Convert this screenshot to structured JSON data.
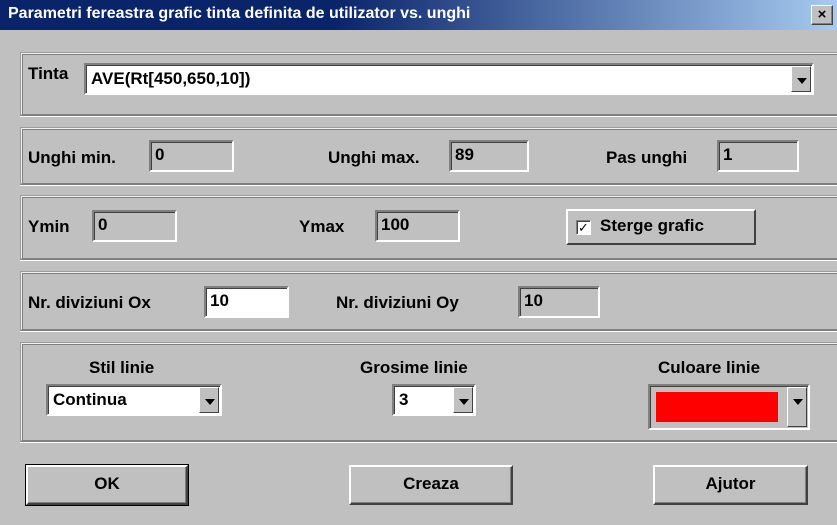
{
  "window": {
    "title": "Parametri fereastra grafic tinta definita de utilizator vs. unghi",
    "close_glyph": "×"
  },
  "tinta": {
    "label": "Tinta",
    "value": "AVE(Rt[450,650,10])"
  },
  "angles": {
    "min_label": "Unghi min.",
    "min_value": "0",
    "max_label": "Unghi max.",
    "max_value": "89",
    "step_label": "Pas unghi",
    "step_value": "1"
  },
  "yrange": {
    "ymin_label": "Ymin",
    "ymin_value": "0",
    "ymax_label": "Ymax",
    "ymax_value": "100",
    "clear_label": "Sterge grafic",
    "clear_checked": true,
    "check_glyph": "✓"
  },
  "divisions": {
    "ox_label": "Nr. diviziuni Ox",
    "ox_value": "10",
    "oy_label": "Nr. diviziuni Oy",
    "oy_value": "10"
  },
  "line": {
    "style_label": "Stil linie",
    "style_value": "Continua",
    "width_label": "Grosime linie",
    "width_value": "3",
    "color_label": "Culoare linie",
    "color_value": "#ff0000"
  },
  "buttons": {
    "ok": "OK",
    "create": "Creaza",
    "help": "Ajutor"
  }
}
